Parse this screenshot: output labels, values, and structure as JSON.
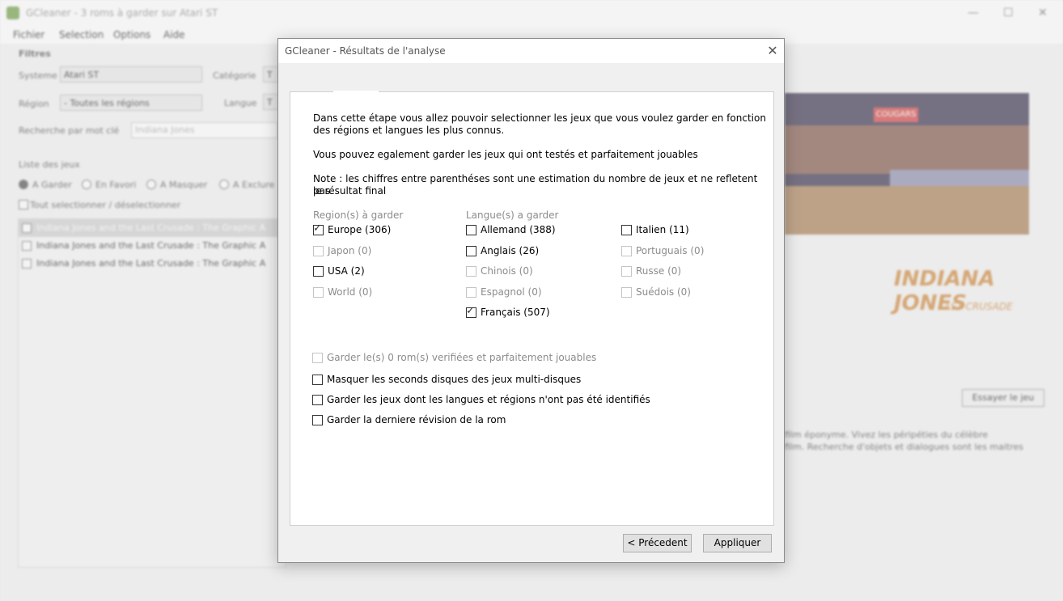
{
  "background": {
    "window_title": "GCleaner - 3 roms à garder sur Atari ST",
    "window_controls": [
      "—",
      "☐",
      "✕"
    ],
    "menu": [
      "Fichier",
      "Selection",
      "Options",
      "Aide"
    ],
    "filters_heading": "Filtres",
    "system_label": "Systeme",
    "system_value": "Atari ST",
    "category_label": "Catégorie",
    "category_value": "T",
    "region_label": "Région",
    "region_value": "- Toutes les régions",
    "language_label": "Langue",
    "language_value": "T",
    "search_label": "Recherche par mot clé",
    "search_value": "Indiana Jones",
    "list_heading": "Liste des jeux",
    "radios": [
      "A Garder",
      "En Favori",
      "A Masquer",
      "A Exclure"
    ],
    "select_all": "Tout selectionner / déselectionner",
    "games": [
      "Indiana Jones and the Last Crusade : The Graphic A",
      "Indiana Jones and the Last Crusade : The Graphic A",
      "Indiana Jones and the Last Crusade : The Graphic A"
    ],
    "screenshot_sign": "COUGARS",
    "logo_line1": "INDIANA JONES",
    "logo_line2": "LAST CRUSADE",
    "try_button": "Essayer le jeu",
    "description_line1": "film éponyme. Vivez les péripéties du célèbre",
    "description_line2": "film. Recherche d'objets et dialogues sont les maitres"
  },
  "dialog": {
    "title": "GCleaner - Résultats de l'analyse",
    "close_glyph": "✕",
    "intro_line1": "Dans cette étape vous allez pouvoir selectionner les jeux que vous voulez garder en fonction",
    "intro_line2": "des régions et langues les plus connus.",
    "playable_text": "Vous pouvez egalement garder les jeux qui ont testés et parfaitement jouables",
    "note_line1": "Note : les chiffres entre parenthéses sont une estimation du nombre de jeux et ne refletent pas",
    "note_line2": "le résultat final",
    "regions_heading": "Region(s) à garder",
    "languages_heading": "Langue(s) a garder",
    "regions": [
      {
        "label": "Europe (306)",
        "checked": true,
        "enabled": true
      },
      {
        "label": "Japon (0)",
        "checked": false,
        "enabled": false
      },
      {
        "label": "USA (2)",
        "checked": false,
        "enabled": true
      },
      {
        "label": "World (0)",
        "checked": false,
        "enabled": false
      }
    ],
    "languages_col1": [
      {
        "label": "Allemand (388)",
        "checked": false,
        "enabled": true
      },
      {
        "label": "Anglais (26)",
        "checked": false,
        "enabled": true
      },
      {
        "label": "Chinois (0)",
        "checked": false,
        "enabled": false
      },
      {
        "label": "Espagnol (0)",
        "checked": false,
        "enabled": false
      },
      {
        "label": "Français (507)",
        "checked": true,
        "enabled": true
      }
    ],
    "languages_col2": [
      {
        "label": "Italien (11)",
        "checked": false,
        "enabled": true
      },
      {
        "label": "Portuguais (0)",
        "checked": false,
        "enabled": false
      },
      {
        "label": "Russe (0)",
        "checked": false,
        "enabled": false
      },
      {
        "label": "Suédois (0)",
        "checked": false,
        "enabled": false
      }
    ],
    "options": [
      {
        "label": "Garder le(s) 0 rom(s) verifiées et parfaitement jouables",
        "checked": false,
        "enabled": false
      },
      {
        "label": "Masquer les seconds disques des jeux multi-disques",
        "checked": false,
        "enabled": true
      },
      {
        "label": "Garder les jeux dont les langues et régions n'ont pas été identifiés",
        "checked": false,
        "enabled": true
      },
      {
        "label": "Garder la derniere révision de la rom",
        "checked": false,
        "enabled": true
      }
    ],
    "check_glyph": "✓",
    "prev_button": "< Précedent",
    "apply_button": "Appliquer"
  }
}
